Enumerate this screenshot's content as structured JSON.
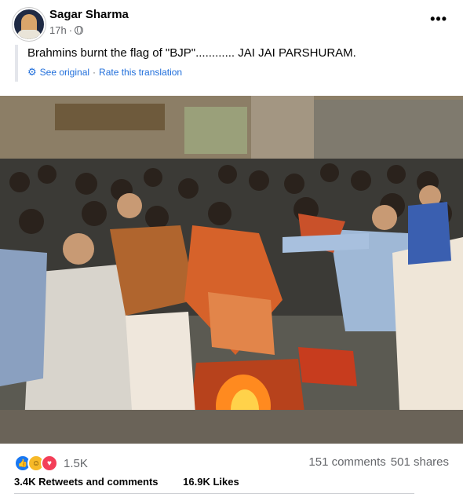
{
  "post": {
    "author": "Sagar Sharma",
    "time": "17h",
    "caption": "Brahmins burnt the flag of \"BJP\"............ JAI JAI PARSHURAM.",
    "see_original": "See original",
    "rate_translation": "Rate this translation",
    "separator": "·"
  },
  "footer": {
    "reaction_count": "1.5K",
    "comments": "151 comments",
    "shares": "501 shares",
    "cropped_left": "3.4K Retweets and comments",
    "cropped_right": "16.9K Likes"
  },
  "icons": [
    "more-options-icon",
    "globe-icon",
    "gear-icon",
    "like-icon",
    "haha-icon",
    "love-icon"
  ],
  "colors": {
    "link": "#216fdb",
    "muted": "#65676b",
    "like": "#1877f2",
    "haha": "#f7b928",
    "love": "#f33e58"
  }
}
